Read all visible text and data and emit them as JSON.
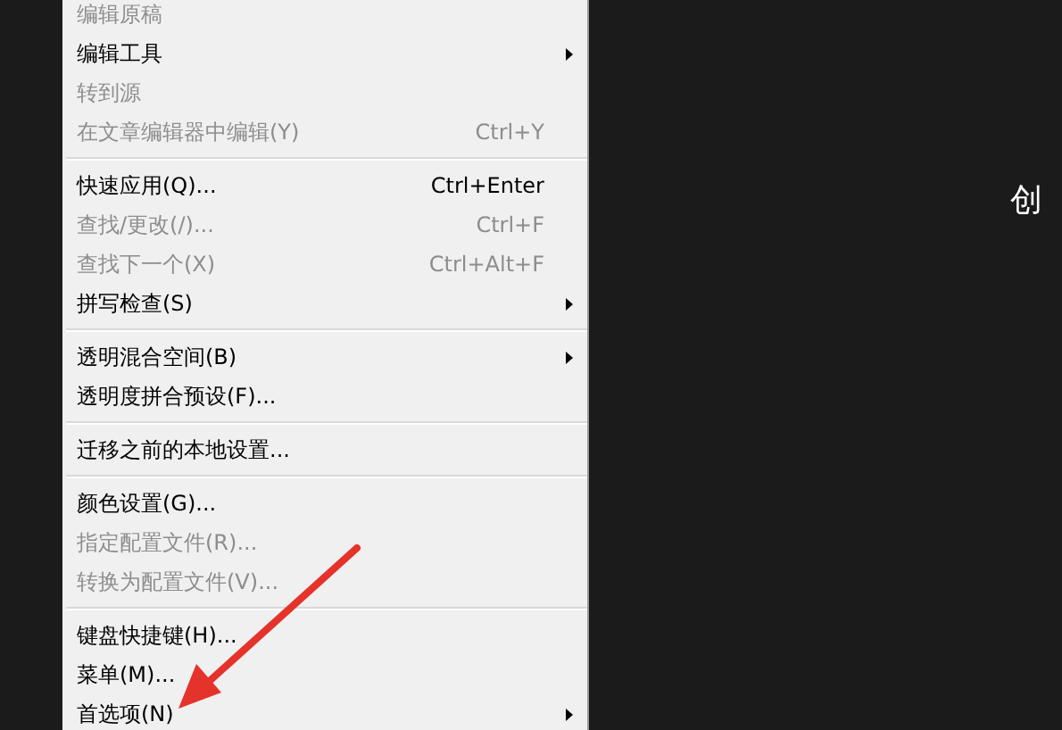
{
  "menu": {
    "items": [
      {
        "kind": "item",
        "label": "编辑原稿",
        "disabled": true
      },
      {
        "kind": "item",
        "label": "编辑工具",
        "disabled": false,
        "submenu": true
      },
      {
        "kind": "item",
        "label": "转到源",
        "disabled": true
      },
      {
        "kind": "item",
        "label": "在文章编辑器中编辑(Y)",
        "disabled": true,
        "shortcut": "Ctrl+Y"
      },
      {
        "kind": "separator"
      },
      {
        "kind": "item",
        "label": "快速应用(Q)...",
        "disabled": false,
        "shortcut": "Ctrl+Enter"
      },
      {
        "kind": "item",
        "label": "查找/更改(/)...",
        "disabled": true,
        "shortcut": "Ctrl+F"
      },
      {
        "kind": "item",
        "label": "查找下一个(X)",
        "disabled": true,
        "shortcut": "Ctrl+Alt+F"
      },
      {
        "kind": "item",
        "label": "拼写检查(S)",
        "disabled": false,
        "submenu": true
      },
      {
        "kind": "separator"
      },
      {
        "kind": "item",
        "label": "透明混合空间(B)",
        "disabled": false,
        "submenu": true
      },
      {
        "kind": "item",
        "label": "透明度拼合预设(F)...",
        "disabled": false
      },
      {
        "kind": "separator"
      },
      {
        "kind": "item",
        "label": "迁移之前的本地设置...",
        "disabled": false
      },
      {
        "kind": "separator"
      },
      {
        "kind": "item",
        "label": "颜色设置(G)...",
        "disabled": false
      },
      {
        "kind": "item",
        "label": "指定配置文件(R)...",
        "disabled": true
      },
      {
        "kind": "item",
        "label": "转换为配置文件(V)...",
        "disabled": true
      },
      {
        "kind": "separator"
      },
      {
        "kind": "item",
        "label": "键盘快捷键(H)...",
        "disabled": false
      },
      {
        "kind": "item",
        "label": "菜单(M)...",
        "disabled": false
      },
      {
        "kind": "item",
        "label": "首选项(N)",
        "disabled": false,
        "submenu": true
      }
    ]
  },
  "canvas": {
    "text": "创"
  },
  "annotation": {
    "kind": "arrow"
  }
}
